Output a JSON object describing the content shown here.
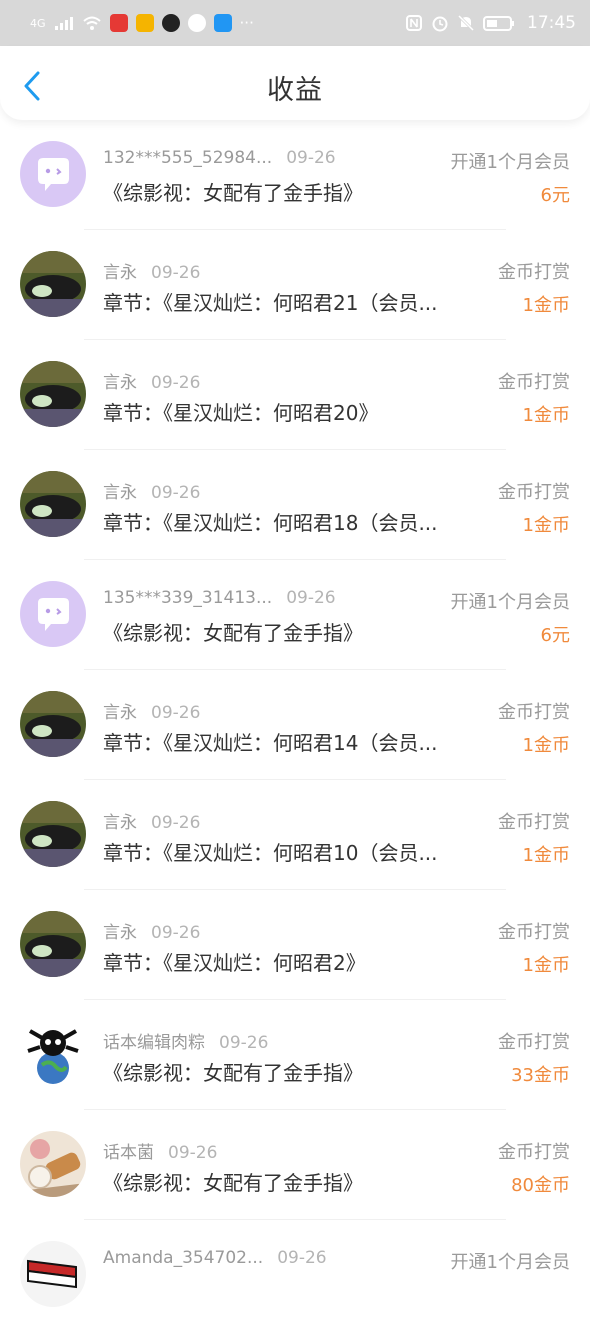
{
  "status_bar": {
    "network": "4G",
    "time": "17:45",
    "more": "···"
  },
  "header": {
    "title": "收益"
  },
  "rows": [
    {
      "avatar": "purple-chat",
      "name": "132***555_52984...",
      "date": "09-26",
      "type": "开通1个月会员",
      "title": "《综影视：女配有了金手指》",
      "amount": "6元"
    },
    {
      "avatar": "cat",
      "name": "言永",
      "date": "09-26",
      "type": "金币打赏",
      "title": "章节：《星汉灿烂：何昭君21（会员...",
      "amount": "1金币"
    },
    {
      "avatar": "cat",
      "name": "言永",
      "date": "09-26",
      "type": "金币打赏",
      "title": "章节：《星汉灿烂：何昭君20》",
      "amount": "1金币"
    },
    {
      "avatar": "cat",
      "name": "言永",
      "date": "09-26",
      "type": "金币打赏",
      "title": "章节：《星汉灿烂：何昭君18（会员...",
      "amount": "1金币"
    },
    {
      "avatar": "purple-chat",
      "name": "135***339_31413...",
      "date": "09-26",
      "type": "开通1个月会员",
      "title": "《综影视：女配有了金手指》",
      "amount": "6元"
    },
    {
      "avatar": "cat",
      "name": "言永",
      "date": "09-26",
      "type": "金币打赏",
      "title": "章节：《星汉灿烂：何昭君14（会员...",
      "amount": "1金币"
    },
    {
      "avatar": "cat",
      "name": "言永",
      "date": "09-26",
      "type": "金币打赏",
      "title": "章节：《星汉灿烂：何昭君10（会员...",
      "amount": "1金币"
    },
    {
      "avatar": "cat",
      "name": "言永",
      "date": "09-26",
      "type": "金币打赏",
      "title": "章节：《星汉灿烂：何昭君2》",
      "amount": "1金币"
    },
    {
      "avatar": "panda",
      "name": "话本编辑肉粽",
      "date": "09-26",
      "type": "金币打赏",
      "title": "《综影视：女配有了金手指》",
      "amount": "33金币"
    },
    {
      "avatar": "food",
      "name": "话本菌",
      "date": "09-26",
      "type": "金币打赏",
      "title": "《综影视：女配有了金手指》",
      "amount": "80金币"
    },
    {
      "avatar": "flag",
      "name": "Amanda_354702...",
      "date": "09-26",
      "type": "开通1个月会员",
      "title": "",
      "amount": ""
    }
  ]
}
